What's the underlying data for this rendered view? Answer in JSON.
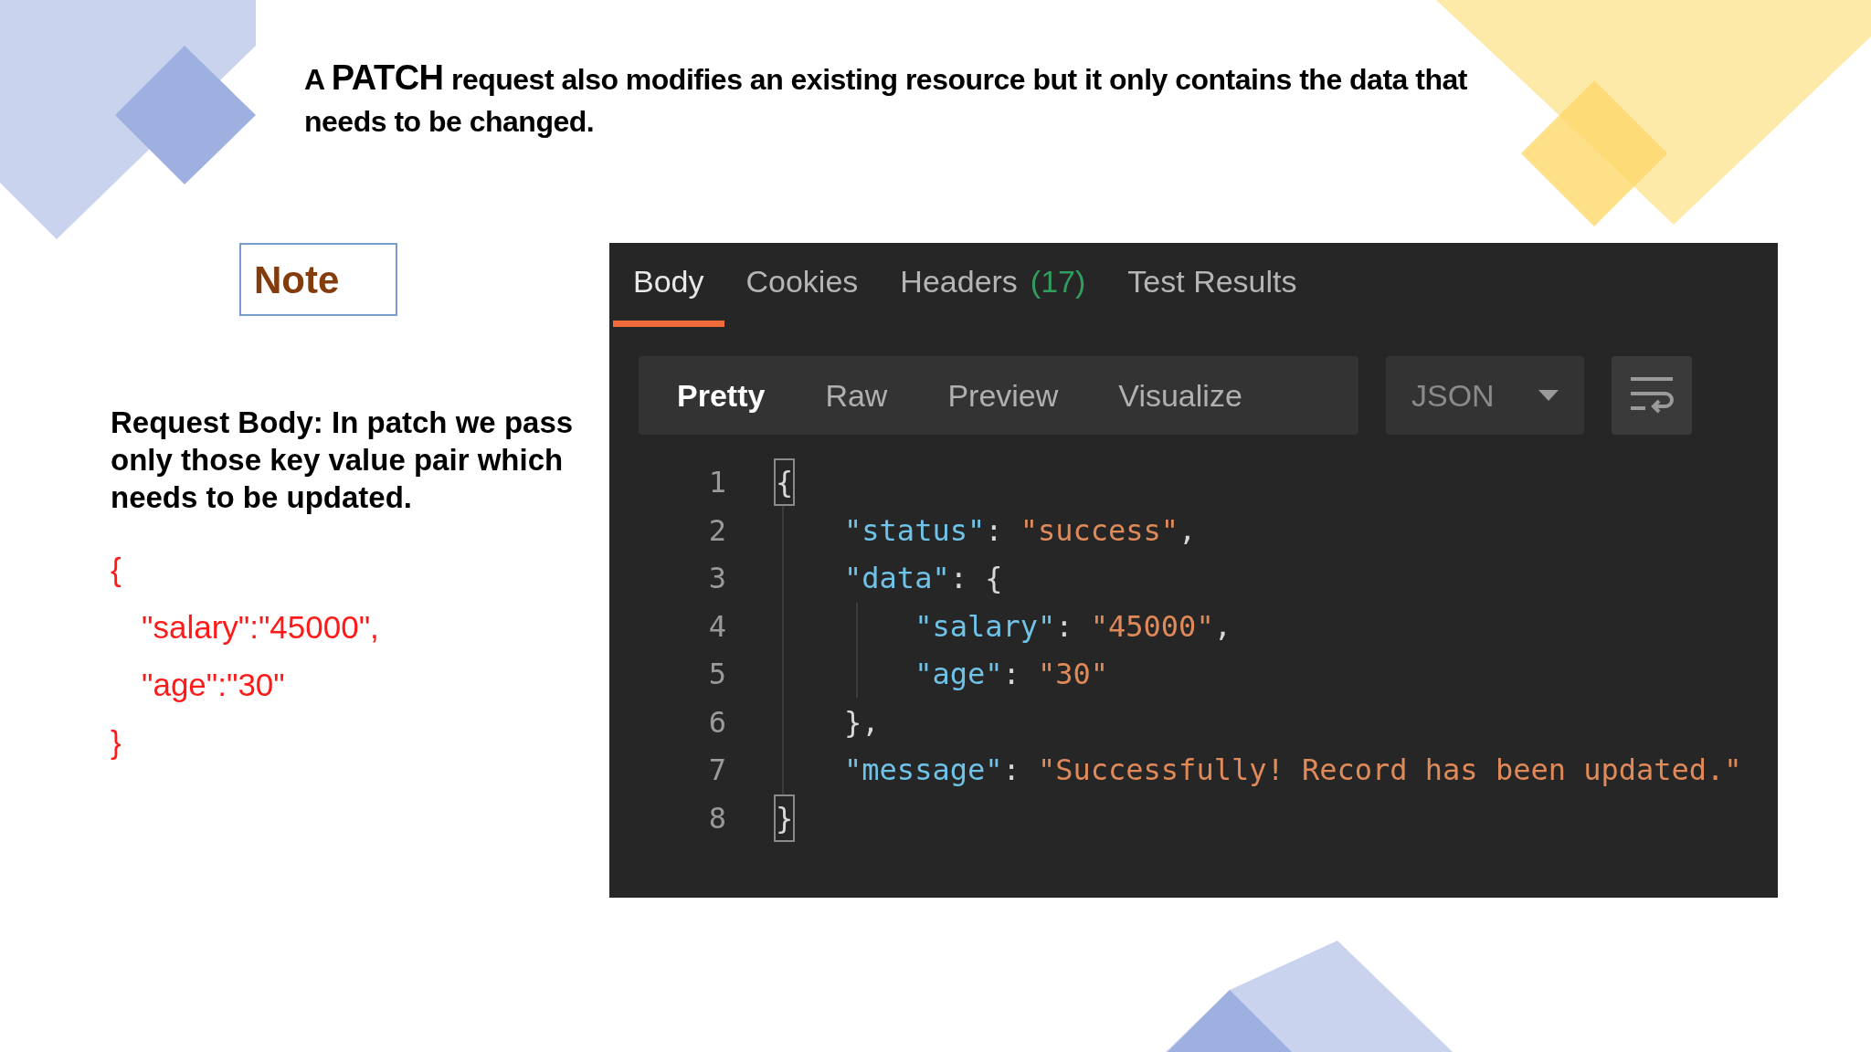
{
  "heading": {
    "lead": "A",
    "keyword": "PATCH",
    "text": "request also modifies an existing resource but it only contains the data that needs to be changed."
  },
  "note_label": "Note",
  "description": "Request Body: In patch we pass only those key value pair which needs to be updated.",
  "request_body": [
    "{",
    "\"salary\":\"45000\",",
    "\"age\":\"30\"",
    "}"
  ],
  "response_panel": {
    "tabs": [
      {
        "label": "Body",
        "selected": true
      },
      {
        "label": "Cookies",
        "selected": false
      },
      {
        "label": "Headers",
        "count": "(17)",
        "selected": false
      },
      {
        "label": "Test Results",
        "selected": false
      }
    ],
    "view_modes": [
      {
        "label": "Pretty",
        "selected": true
      },
      {
        "label": "Raw",
        "selected": false
      },
      {
        "label": "Preview",
        "selected": false
      },
      {
        "label": "Visualize",
        "selected": false
      }
    ],
    "format": "JSON",
    "code_lines": [
      {
        "number": "1",
        "tokens": [
          {
            "kind": "punct",
            "text": "{",
            "highlighted": true
          }
        ]
      },
      {
        "number": "2",
        "tokens": [
          {
            "kind": "key",
            "text": "    \"status\""
          },
          {
            "kind": "punct",
            "text": ": "
          },
          {
            "kind": "string",
            "text": "\"success\""
          },
          {
            "kind": "punct",
            "text": ","
          }
        ]
      },
      {
        "number": "3",
        "tokens": [
          {
            "kind": "key",
            "text": "    \"data\""
          },
          {
            "kind": "punct",
            "text": ": {"
          }
        ]
      },
      {
        "number": "4",
        "tokens": [
          {
            "kind": "key",
            "text": "        \"salary\""
          },
          {
            "kind": "punct",
            "text": ": "
          },
          {
            "kind": "string",
            "text": "\"45000\""
          },
          {
            "kind": "punct",
            "text": ","
          }
        ]
      },
      {
        "number": "5",
        "tokens": [
          {
            "kind": "key",
            "text": "        \"age\""
          },
          {
            "kind": "punct",
            "text": ": "
          },
          {
            "kind": "string",
            "text": "\"30\""
          }
        ]
      },
      {
        "number": "6",
        "tokens": [
          {
            "kind": "punct",
            "text": "    },"
          }
        ]
      },
      {
        "number": "7",
        "tokens": [
          {
            "kind": "key",
            "text": "    \"message\""
          },
          {
            "kind": "punct",
            "text": ": "
          },
          {
            "kind": "string",
            "text": "\"Successfully! Record has been updated.\""
          }
        ]
      },
      {
        "number": "8",
        "tokens": [
          {
            "kind": "punct",
            "text": "}",
            "highlighted": true
          }
        ]
      }
    ]
  }
}
